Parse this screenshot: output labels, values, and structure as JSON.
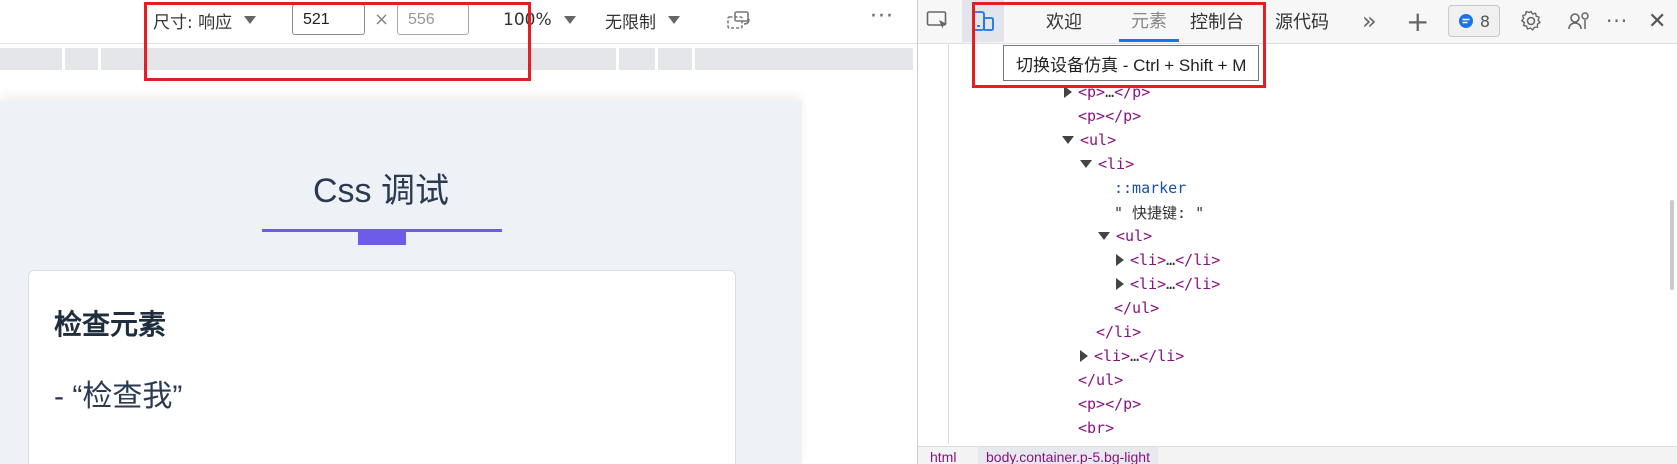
{
  "emulation_toolbar": {
    "dimensions_label": "尺寸: 响应",
    "width_value": "521",
    "height_value": "556",
    "times_symbol": "×",
    "zoom_label": "100%",
    "throttle_label": "无限制",
    "more_label": "···"
  },
  "page": {
    "title": "Css 调试",
    "card_heading": "检查元素",
    "card_text": "- “检查我”",
    "accent_color": "#6c5ce7"
  },
  "devtools": {
    "tabs": [
      {
        "label": "欢迎"
      },
      {
        "label": "元素"
      },
      {
        "label": "控制台"
      },
      {
        "label": "源代码"
      }
    ],
    "more_tabs_label": "»",
    "add_tab_label": "+",
    "issues_count": "8",
    "more_label": "···",
    "close_label": "✕",
    "tooltip": "切换设备仿真 - Ctrl + Shift + M"
  },
  "dom_tree": [
    {
      "open": "<p>",
      "mid": "…",
      "close": "</p>"
    },
    {
      "open": "<p>",
      "mid": "",
      "close": "</p>"
    },
    {
      "open": "<ul>",
      "mid": "",
      "close": ""
    },
    {
      "open": "<li>",
      "mid": "",
      "close": ""
    },
    {
      "pseudo": "::marker"
    },
    {
      "text": "\" 快捷键: \""
    },
    {
      "open": "<ul>",
      "mid": "",
      "close": ""
    },
    {
      "open": "<li>",
      "mid": "…",
      "close": "</li>"
    },
    {
      "open": "<li>",
      "mid": "…",
      "close": "</li>"
    },
    {
      "open": "",
      "mid": "",
      "close": "</ul>"
    },
    {
      "open": "",
      "mid": "",
      "close": "</li>"
    },
    {
      "open": "<li>",
      "mid": "…",
      "close": "</li>"
    },
    {
      "open": "",
      "mid": "",
      "close": "</ul>"
    },
    {
      "open": "<p>",
      "mid": "",
      "close": "</p>"
    },
    {
      "open": "<br>",
      "mid": "",
      "close": ""
    }
  ],
  "breadcrumbs": [
    "html",
    "body.container.p-5.bg-light"
  ],
  "colors": {
    "highlight": "#e31e24",
    "tag": "#881280",
    "tab_active_underline": "#1a73e8"
  }
}
